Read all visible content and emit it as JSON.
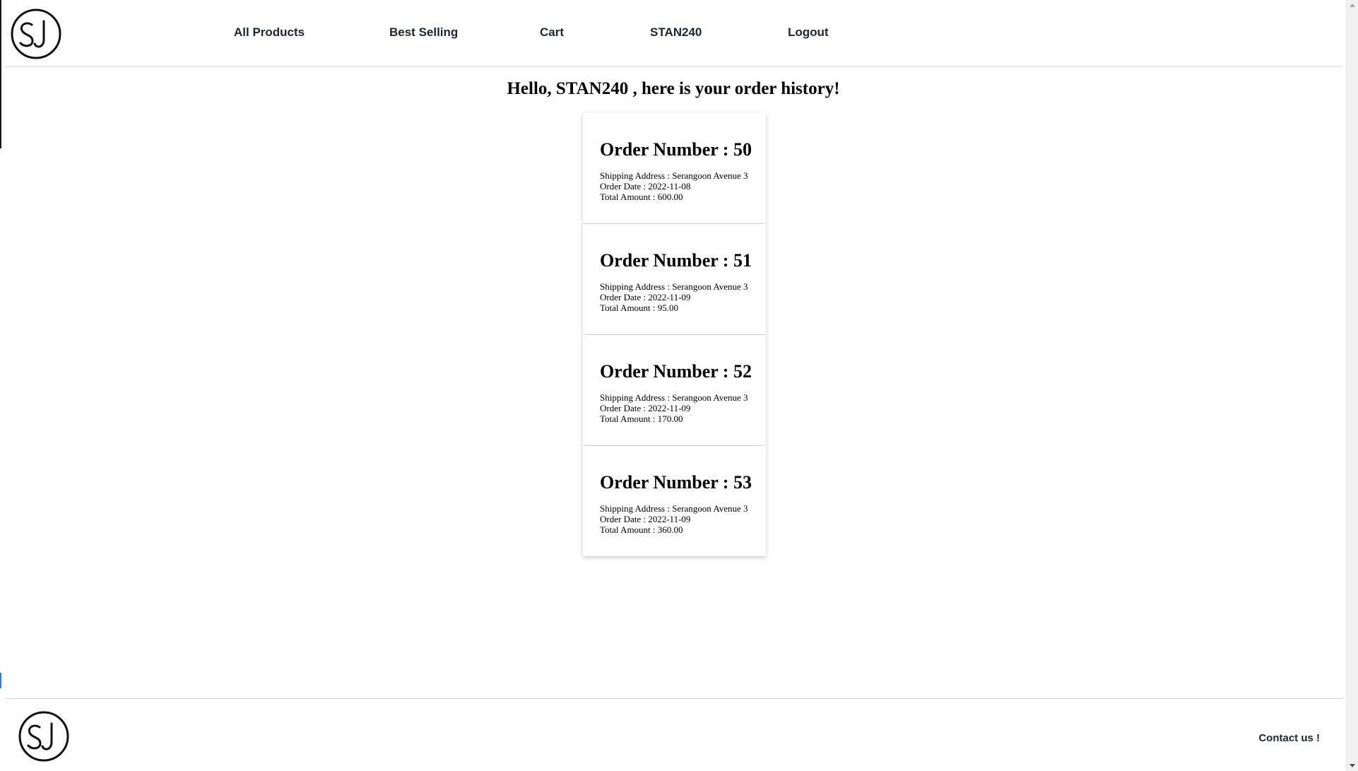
{
  "header": {
    "logo_text": "SJ",
    "nav": [
      {
        "label": "All Products"
      },
      {
        "label": "Best Selling"
      },
      {
        "label": "Cart"
      },
      {
        "label": "STAN240"
      },
      {
        "label": "Logout"
      }
    ]
  },
  "main": {
    "greeting": "Hello, STAN240 , here is your order history!",
    "orders": [
      {
        "title": "Order Number : 50",
        "shipping": "Shipping Address : Serangoon Avenue 3",
        "date": "Order Date : 2022-11-08",
        "total": "Total Amount : 600.00"
      },
      {
        "title": "Order Number : 51",
        "shipping": "Shipping Address : Serangoon Avenue 3",
        "date": "Order Date : 2022-11-09",
        "total": "Total Amount : 95.00"
      },
      {
        "title": "Order Number : 52",
        "shipping": "Shipping Address : Serangoon Avenue 3",
        "date": "Order Date : 2022-11-09",
        "total": "Total Amount : 170.00"
      },
      {
        "title": "Order Number : 53",
        "shipping": "Shipping Address : Serangoon Avenue 3",
        "date": "Order Date : 2022-11-09",
        "total": "Total Amount : 360.00"
      }
    ]
  },
  "footer": {
    "logo_text": "SJ",
    "contact_label": "Contact us !"
  }
}
